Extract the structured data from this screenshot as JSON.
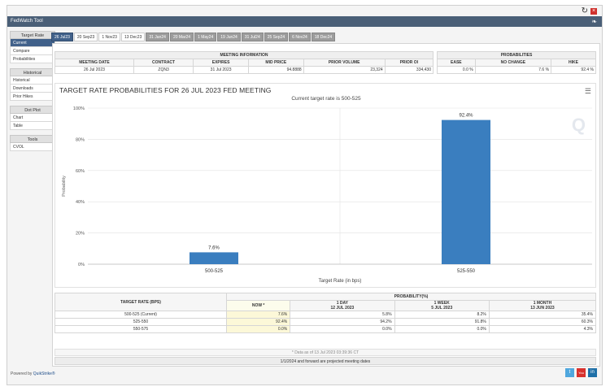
{
  "window": {
    "title": "FedWatch Tool",
    "refresh_icon": "↻",
    "close_icon": "×",
    "twitter_icon": "❧"
  },
  "sidebar": {
    "groups": [
      {
        "label": "Target Rate",
        "items": [
          "Current",
          "Compare",
          "Probabilities"
        ]
      },
      {
        "label": "Historical",
        "items": [
          "Historical",
          "Downloads",
          "Prior Hikes"
        ]
      },
      {
        "label": "Dot Plot",
        "items": [
          "Chart",
          "Table"
        ]
      },
      {
        "label": "Tools",
        "items": [
          "CVOL"
        ]
      }
    ],
    "active_item": "Current"
  },
  "tabs": [
    "26 Jul23",
    "20 Sep23",
    "1 Nov23",
    "13 Dec23",
    "31 Jan24",
    "20 Mar24",
    "1 May24",
    "19 Jun24",
    "31 Jul24",
    "25 Sep24",
    "6 Nov24",
    "18 Dec24"
  ],
  "meeting_info": {
    "header": "MEETING INFORMATION",
    "columns": [
      "MEETING DATE",
      "CONTRACT",
      "EXPIRES",
      "MID PRICE",
      "PRIOR VOLUME",
      "PRIOR OI"
    ],
    "values": [
      "26 Jul 2023",
      "ZQN3",
      "31 Jul 2023",
      "94.8888",
      "23,324",
      "334,430"
    ]
  },
  "probabilities": {
    "header": "PROBABILITIES",
    "columns": [
      "EASE",
      "NO CHANGE",
      "HIKE"
    ],
    "values": [
      "0.0 %",
      "7.6 %",
      "92.4 %"
    ]
  },
  "chart_data": {
    "type": "bar",
    "title": "TARGET RATE PROBABILITIES FOR 26 JUL 2023 FED MEETING",
    "subtitle": "Current target rate is 500-525",
    "xlabel": "Target Rate (in bps)",
    "ylabel": "Probability",
    "categories": [
      "500-525",
      "525-550"
    ],
    "values": [
      7.6,
      92.4
    ],
    "data_labels": [
      "7.6%",
      "92.4%"
    ],
    "ylim": [
      0,
      100
    ],
    "yticks": [
      0,
      20,
      40,
      60,
      80,
      100
    ],
    "ytick_labels": [
      "0%",
      "20%",
      "40%",
      "60%",
      "80%",
      "100%"
    ],
    "bar_color": "#3a7ebf",
    "grid": true,
    "watermark": "Q"
  },
  "prob_table": {
    "target_header": "TARGET RATE (BPS)",
    "prob_header": "PROBABILITY(%)",
    "columns": [
      {
        "l1": "NOW *",
        "l2": ""
      },
      {
        "l1": "1 DAY",
        "l2": "12 JUL 2023"
      },
      {
        "l1": "1 WEEK",
        "l2": "5 JUL 2023"
      },
      {
        "l1": "1 MONTH",
        "l2": "13 JUN 2023"
      }
    ],
    "rows": [
      {
        "rate": "500-525 (Current)",
        "vals": [
          "7.6%",
          "5.8%",
          "8.2%",
          "35.4%"
        ]
      },
      {
        "rate": "525-550",
        "vals": [
          "92.4%",
          "94.2%",
          "91.8%",
          "60.3%"
        ]
      },
      {
        "rate": "550-575",
        "vals": [
          "0.0%",
          "0.0%",
          "0.0%",
          "4.3%"
        ]
      }
    ],
    "note": "* Data as of 13 Jul 2023 03:39:36 CT",
    "footnote": "1/1/2024 and forward are projected meeting dates"
  },
  "footer": {
    "powered_prefix": "Powered by",
    "brand": "QuikStrike®",
    "social": [
      {
        "name": "twitter",
        "glyph": "t"
      },
      {
        "name": "youtube",
        "glyph": "You"
      },
      {
        "name": "linkedin",
        "glyph": "in"
      }
    ]
  },
  "colors": {
    "header_bar": "#4a5f77",
    "active_tab": "#41618a",
    "bar": "#3a7ebf",
    "highlight_cell": "#fcf8d8"
  }
}
